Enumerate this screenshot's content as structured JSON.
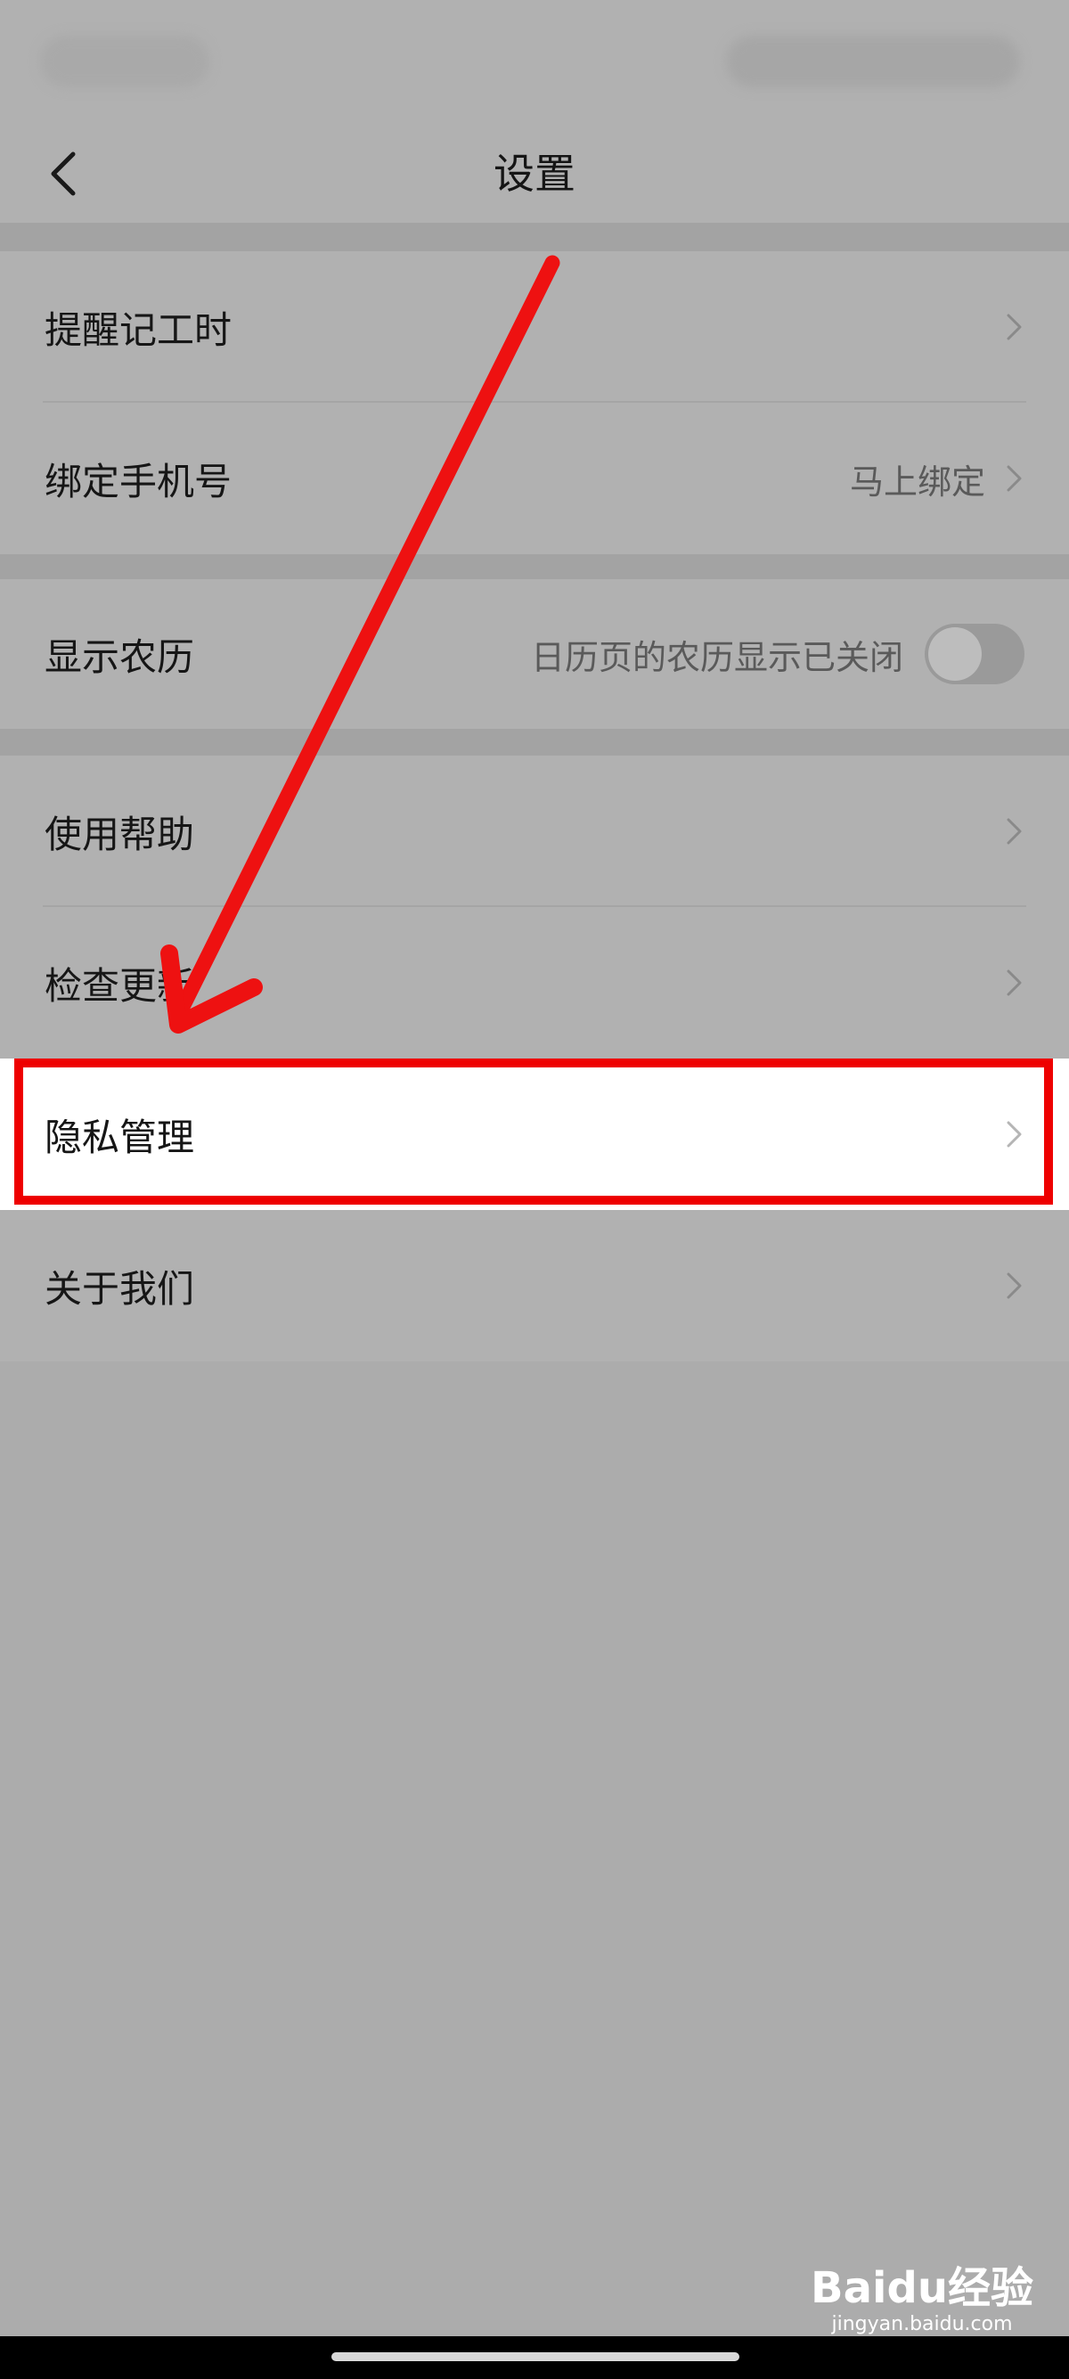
{
  "header": {
    "title": "设置",
    "back_icon": "chevron-left-icon"
  },
  "groups": [
    {
      "items": [
        {
          "label": "提醒记工时",
          "value": ""
        },
        {
          "label": "绑定手机号",
          "value": "马上绑定"
        }
      ]
    },
    {
      "items": [
        {
          "label": "显示农历",
          "value": "日历页的农历显示已关闭",
          "toggle_on": false
        }
      ]
    },
    {
      "items": [
        {
          "label": "使用帮助",
          "value": ""
        },
        {
          "label": "检查更新",
          "value": ""
        },
        {
          "label": "隐私管理",
          "value": "",
          "highlighted": true
        },
        {
          "label": "关于我们",
          "value": ""
        }
      ]
    }
  ],
  "annotation": {
    "arrow_color": "#ee0000",
    "box_color": "#ee0000"
  },
  "watermark": {
    "logo": "Baidu经验",
    "url": "jingyan.baidu.com"
  }
}
